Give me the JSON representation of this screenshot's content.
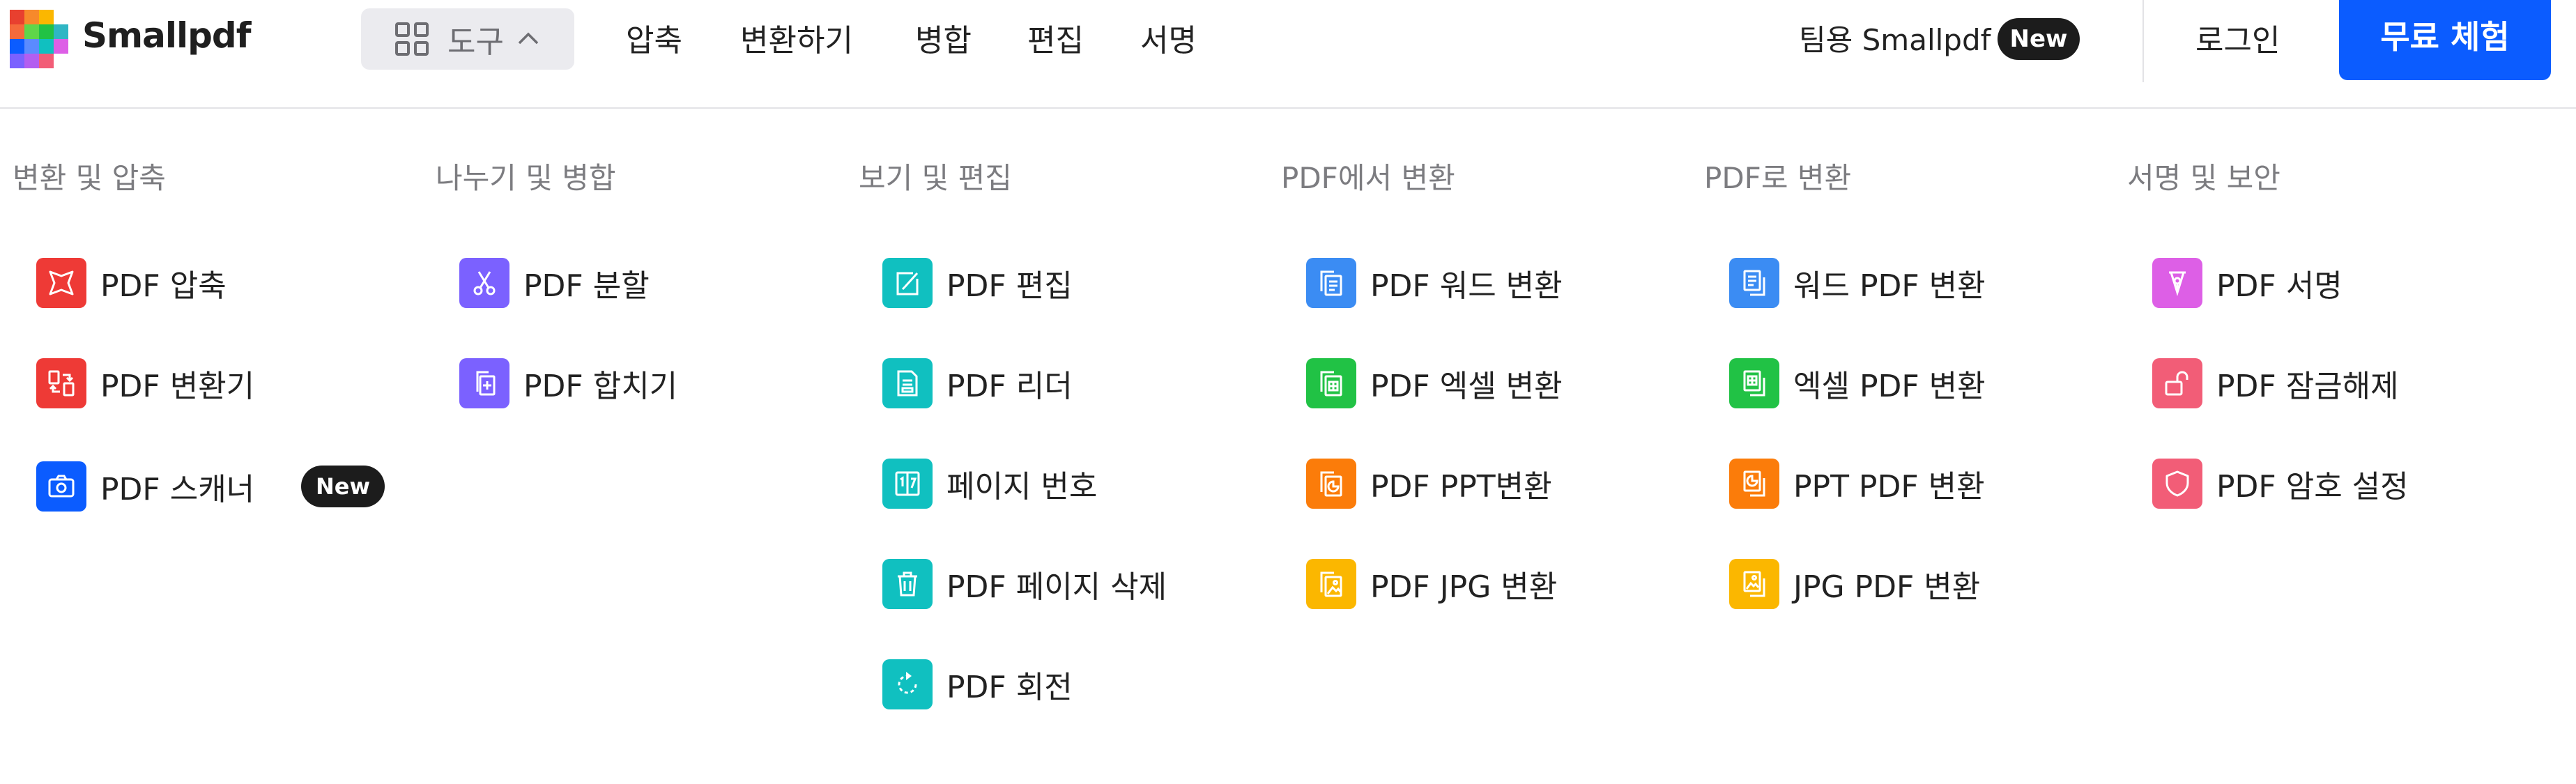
{
  "header": {
    "brand": "Smallpdf",
    "tools_label": "도구",
    "nav": [
      {
        "label": "압축"
      },
      {
        "label": "변환하기"
      },
      {
        "label": "병합"
      },
      {
        "label": "편집"
      },
      {
        "label": "서명"
      }
    ],
    "team_label": "팀용 Smallpdf",
    "team_badge": "New",
    "login_label": "로그인",
    "trial_label": "무료 체험"
  },
  "colors": {
    "red": "#ee3a36",
    "purple": "#7b61ff",
    "teal": "#10c0c0",
    "blue": "#3b8cf3",
    "green": "#21c245",
    "orange": "#fb7c0a",
    "yellow": "#fbb700",
    "magenta": "#dd5fe6",
    "pink": "#f25d77",
    "scanner_blue": "#0b5cff",
    "trial_blue": "#0b5cff"
  },
  "menu": {
    "columns": [
      {
        "title": "변환 및 압축",
        "items": [
          {
            "label": "PDF 압축",
            "icon": "compress-icon"
          },
          {
            "label": "PDF 변환기",
            "icon": "convert-icon"
          },
          {
            "label": "PDF 스캐너",
            "icon": "camera-icon",
            "badge": "New"
          }
        ]
      },
      {
        "title": "나누기 및 병합",
        "items": [
          {
            "label": "PDF 분할",
            "icon": "scissors-icon"
          },
          {
            "label": "PDF 합치기",
            "icon": "merge-icon"
          }
        ]
      },
      {
        "title": "보기 및 편집",
        "items": [
          {
            "label": "PDF 편집",
            "icon": "edit-icon"
          },
          {
            "label": "PDF 리더",
            "icon": "reader-icon"
          },
          {
            "label": "페이지 번호",
            "icon": "page-number-icon"
          },
          {
            "label": "PDF 페이지 삭제",
            "icon": "trash-icon"
          },
          {
            "label": "PDF 회전",
            "icon": "rotate-icon"
          }
        ]
      },
      {
        "title": "PDF에서 변환",
        "items": [
          {
            "label": "PDF 워드 변환",
            "icon": "word-icon"
          },
          {
            "label": "PDF 엑셀 변환",
            "icon": "excel-icon"
          },
          {
            "label": "PDF PPT변환",
            "icon": "ppt-icon"
          },
          {
            "label": "PDF JPG 변환",
            "icon": "jpg-icon"
          }
        ]
      },
      {
        "title": "PDF로 변환",
        "items": [
          {
            "label": "워드 PDF 변환",
            "icon": "word-icon"
          },
          {
            "label": "엑셀 PDF 변환",
            "icon": "excel-icon"
          },
          {
            "label": "PPT PDF 변환",
            "icon": "ppt-icon"
          },
          {
            "label": "JPG PDF 변환",
            "icon": "jpg-icon"
          }
        ]
      },
      {
        "title": "서명 및 보안",
        "items": [
          {
            "label": "PDF 서명",
            "icon": "pen-icon"
          },
          {
            "label": "PDF 잠금해제",
            "icon": "unlock-icon"
          },
          {
            "label": "PDF 암호 설정",
            "icon": "shield-icon"
          }
        ]
      }
    ]
  }
}
